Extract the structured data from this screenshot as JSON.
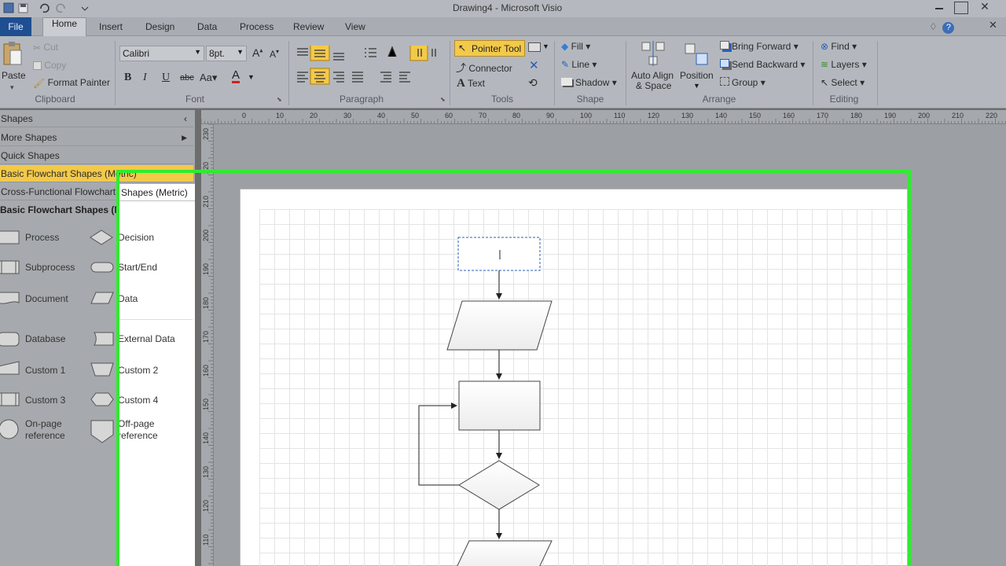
{
  "window": {
    "title": "Drawing4 - Microsoft Visio"
  },
  "tabs": [
    {
      "label": "File"
    },
    {
      "label": "Home"
    },
    {
      "label": "Insert"
    },
    {
      "label": "Design"
    },
    {
      "label": "Data"
    },
    {
      "label": "Process"
    },
    {
      "label": "Review"
    },
    {
      "label": "View"
    }
  ],
  "clipboard": {
    "paste": "Paste",
    "cut": "Cut",
    "copy": "Copy",
    "format_painter": "Format Painter",
    "label": "Clipboard"
  },
  "font": {
    "name": "Calibri",
    "size": "8pt.",
    "label": "Font"
  },
  "paragraph": {
    "label": "Paragraph"
  },
  "tools": {
    "pointer": "Pointer Tool",
    "connector": "Connector",
    "text": "Text",
    "label": "Tools"
  },
  "shape": {
    "fill": "Fill",
    "line": "Line",
    "shadow": "Shadow",
    "label": "Shape"
  },
  "arrange": {
    "auto_align": "Auto Align",
    "auto_align2": "& Space",
    "position": "Position",
    "bring_forward": "Bring Forward",
    "send_backward": "Send Backward",
    "group": "Group",
    "label": "Arrange"
  },
  "editing": {
    "find": "Find",
    "layers": "Layers",
    "select": "Select",
    "label": "Editing"
  },
  "shapes_pane": {
    "title": "Shapes",
    "more": "More Shapes",
    "quick": "Quick Shapes",
    "stencil1": "Basic Flowchart Shapes (Metric)",
    "stencil2": "Cross-Functional Flowchart Shapes (Metric)",
    "tooltip": "Shapes (Metric)",
    "heading": "Basic Flowchart Shapes (Metric)",
    "items": {
      "process": "Process",
      "decision": "Decision",
      "subprocess": "Subprocess",
      "startend": "Start/End",
      "document": "Document",
      "data": "Data",
      "database": "Database",
      "external": "External Data",
      "custom1": "Custom 1",
      "custom2": "Custom 2",
      "custom3": "Custom 3",
      "custom4": "Custom 4",
      "onpage1": "On-page",
      "onpage2": "reference",
      "offpage1": "Off-page",
      "offpage2": "reference"
    }
  },
  "ruler_top": [
    "0",
    "10",
    "20",
    "30",
    "40",
    "50",
    "60",
    "70",
    "80",
    "90",
    "100",
    "110",
    "120",
    "130",
    "140",
    "150",
    "160",
    "170",
    "180",
    "190",
    "200",
    "210",
    "220",
    "230"
  ],
  "ruler_left": [
    "230",
    "220",
    "210",
    "200",
    "190",
    "180",
    "170",
    "160",
    "150",
    "140",
    "130",
    "120",
    "110",
    "100"
  ],
  "colors": {
    "highlight": "#2ded2d",
    "file_tab": "#1f4e91",
    "selected_stencil": "#f3c94a"
  }
}
